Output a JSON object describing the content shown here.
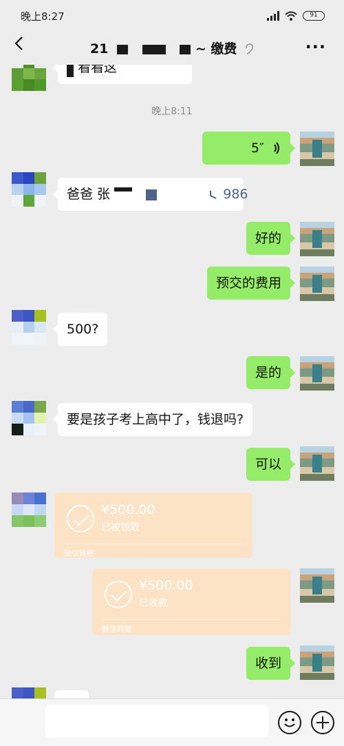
{
  "status_bar": {
    "time": "晚上8:27",
    "battery": "91"
  },
  "header": {
    "title_prefix": "21",
    "title_suffix": "~ 缴费"
  },
  "messages": {
    "m0_text": "看看这",
    "timestamp": "晚上8:11",
    "m1_voice_duration": "5″",
    "m2_text": "爸爸 张",
    "m2_tail": "986",
    "m3_text": "好的",
    "m4_text": "预交的费用",
    "m5_text": "500?",
    "m6_text": "是的",
    "m7_text": "要是孩子考上高中了，钱退吗?",
    "m8_text": "可以",
    "m11_text": "收到"
  },
  "transfers": [
    {
      "amount": "¥500.00",
      "status": "已被领取",
      "label": "微信转账"
    },
    {
      "amount": "¥500.00",
      "status": "已收款",
      "label": "微信转账"
    }
  ],
  "colors": {
    "outgoing_bubble": "#95ec69",
    "incoming_bubble": "#ffffff",
    "transfer_card": "#fce3c6",
    "background": "#ededed"
  },
  "icons": [
    "back-icon",
    "earpiece-icon",
    "more-icon",
    "voice-icon",
    "reply-icon",
    "check-icon",
    "emoji-icon",
    "plus-icon"
  ]
}
